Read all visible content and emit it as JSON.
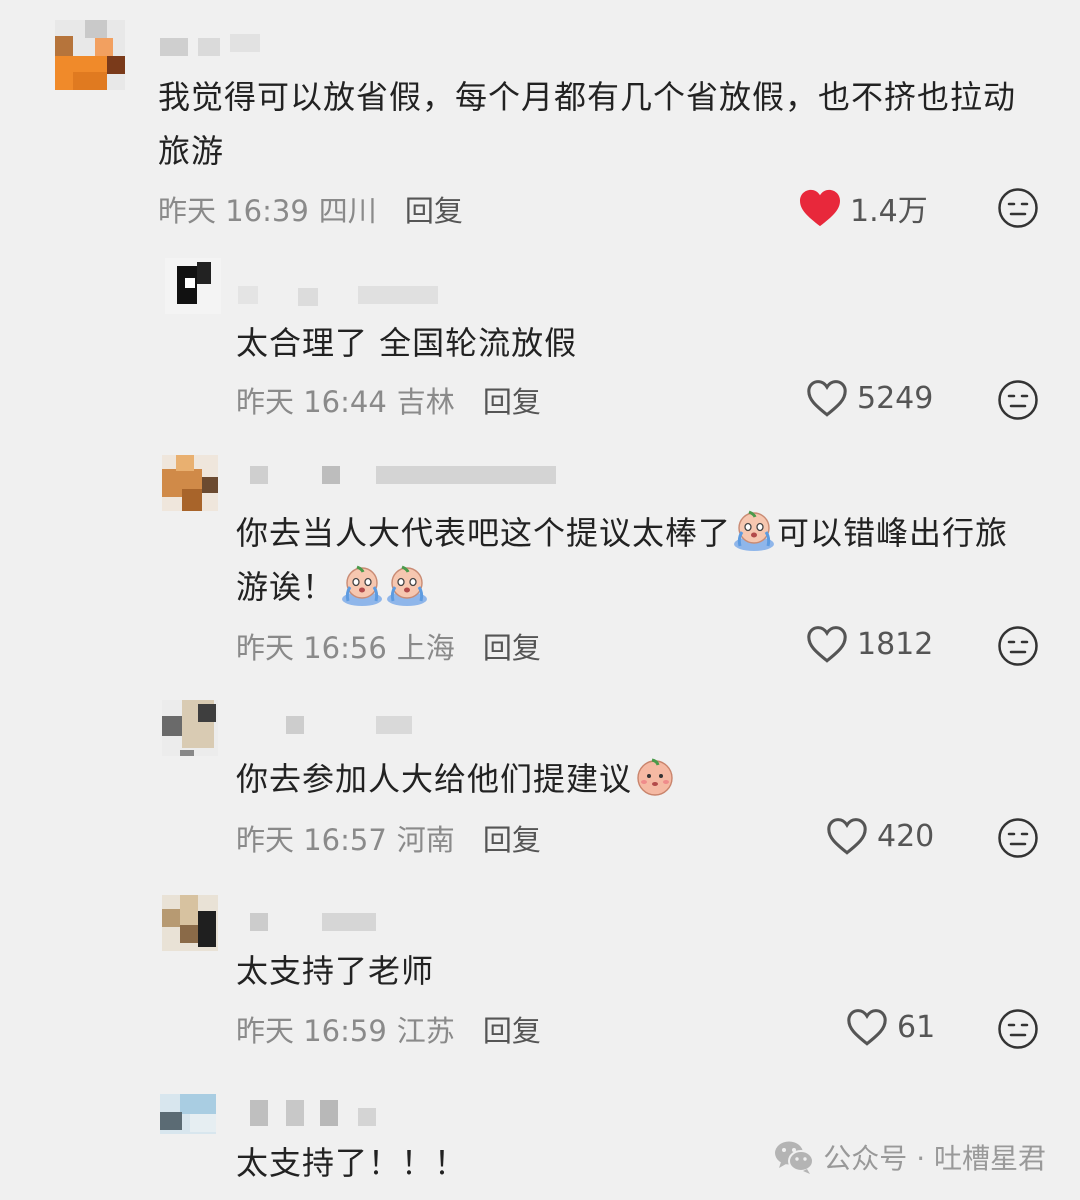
{
  "comments": [
    {
      "text": "我觉得可以放省假，每个月都有几个省放假，也不挤也拉动旅游",
      "time": "昨天 16:39",
      "location": "四川",
      "reply": "回复",
      "likes": "1.4万",
      "liked": true
    },
    {
      "text": "太合理了 全国轮流放假",
      "time": "昨天 16:44",
      "location": "吉林",
      "reply": "回复",
      "likes": "5249",
      "liked": false
    },
    {
      "text_a": "你去当人大代表吧这个提议太棒了",
      "text_b": "可以错峰出行旅游诶！",
      "time": "昨天 16:56",
      "location": "上海",
      "reply": "回复",
      "likes": "1812",
      "liked": false
    },
    {
      "text": "你去参加人大给他们提建议",
      "time": "昨天 16:57",
      "location": "河南",
      "reply": "回复",
      "likes": "420",
      "liked": false
    },
    {
      "text": "太支持了老师",
      "time": "昨天 16:59",
      "location": "江苏",
      "reply": "回复",
      "likes": "61",
      "liked": false
    },
    {
      "text": "太支持了！！！"
    }
  ],
  "watermark": {
    "icon": "wechat-icon",
    "text": "公众号 · 吐槽星君"
  },
  "colors": {
    "background": "#f0f0f0",
    "like_red": "#e8283b",
    "meta_gray": "#8a8a8a"
  }
}
